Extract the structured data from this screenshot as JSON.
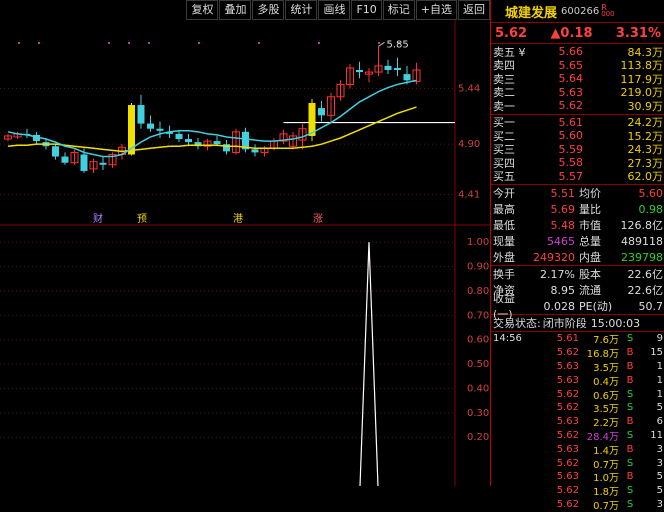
{
  "toolbar": {
    "buttons": [
      "复权",
      "叠加",
      "多股",
      "统计",
      "画线",
      "F10",
      "标记",
      "+自选",
      "返回"
    ]
  },
  "stock": {
    "name": "城建发展",
    "code": "600266",
    "badge_top": "R",
    "badge_bottom": "000",
    "price": "5.62",
    "change": "▲0.18",
    "change_pct": "3.31%"
  },
  "orderbook": {
    "asks": [
      {
        "label": "卖五 ¥",
        "price": "5.66",
        "vol": "84.3万"
      },
      {
        "label": "卖四",
        "price": "5.65",
        "vol": "113.8万"
      },
      {
        "label": "卖三",
        "price": "5.64",
        "vol": "117.9万"
      },
      {
        "label": "卖二",
        "price": "5.63",
        "vol": "219.0万"
      },
      {
        "label": "卖一",
        "price": "5.62",
        "vol": "30.9万"
      }
    ],
    "bids": [
      {
        "label": "买一",
        "price": "5.61",
        "vol": "24.2万"
      },
      {
        "label": "买二",
        "price": "5.60",
        "vol": "15.2万"
      },
      {
        "label": "买三",
        "price": "5.59",
        "vol": "24.3万"
      },
      {
        "label": "买四",
        "price": "5.58",
        "vol": "27.3万"
      },
      {
        "label": "买五",
        "price": "5.57",
        "vol": "62.0万"
      }
    ]
  },
  "stats": [
    {
      "l1": "今开",
      "v1": "5.51",
      "c1": "#ff4040",
      "l2": "均价",
      "v2": "5.60",
      "c2": "#ff4040"
    },
    {
      "l1": "最高",
      "v1": "5.69",
      "c1": "#ff4040",
      "l2": "量比",
      "v2": "0.98",
      "c2": "#30d030"
    },
    {
      "l1": "最低",
      "v1": "5.48",
      "c1": "#ff4040",
      "l2": "市值",
      "v2": "126.8亿",
      "c2": "#dddddd"
    },
    {
      "l1": "现量",
      "v1": "5465",
      "c1": "#d040d0",
      "l2": "总量",
      "v2": "489118",
      "c2": "#dddddd"
    },
    {
      "l1": "外盘",
      "v1": "249320",
      "c1": "#ff4040",
      "l2": "内盘",
      "v2": "239798",
      "c2": "#30d030"
    }
  ],
  "stats2": [
    {
      "l1": "换手",
      "v1": "2.17%",
      "c1": "#dddddd",
      "l2": "股本",
      "v2": "22.6亿",
      "c2": "#dddddd"
    },
    {
      "l1": "净资",
      "v1": "8.95",
      "c1": "#dddddd",
      "l2": "流通",
      "v2": "22.6亿",
      "c2": "#dddddd"
    },
    {
      "l1": "收益(一)",
      "v1": "0.028",
      "c1": "#dddddd",
      "l2": "PE(动)",
      "v2": "50.7",
      "c2": "#dddddd"
    }
  ],
  "status": {
    "label": "交易状态:",
    "value": "闭市阶段",
    "time": "15:00:03"
  },
  "ticks": [
    {
      "time": "14:56",
      "price": "5.61",
      "vol": "7.6万",
      "vol_color": "#f0d000",
      "side": "S",
      "n": "9"
    },
    {
      "time": "",
      "price": "5.62",
      "vol": "16.8万",
      "vol_color": "#f0d000",
      "side": "B",
      "n": "15"
    },
    {
      "time": "",
      "price": "5.63",
      "vol": "3.5万",
      "vol_color": "#f0d000",
      "side": "B",
      "n": "1"
    },
    {
      "time": "",
      "price": "5.63",
      "vol": "0.4万",
      "vol_color": "#f0d000",
      "side": "B",
      "n": "1"
    },
    {
      "time": "",
      "price": "5.62",
      "vol": "0.6万",
      "vol_color": "#f0d000",
      "side": "S",
      "n": "1"
    },
    {
      "time": "",
      "price": "5.62",
      "vol": "3.5万",
      "vol_color": "#f0d000",
      "side": "S",
      "n": "5"
    },
    {
      "time": "",
      "price": "5.63",
      "vol": "2.2万",
      "vol_color": "#f0d000",
      "side": "B",
      "n": "6"
    },
    {
      "time": "",
      "price": "5.62",
      "vol": "28.4万",
      "vol_color": "#d040d0",
      "side": "S",
      "n": "11"
    },
    {
      "time": "",
      "price": "5.63",
      "vol": "1.4万",
      "vol_color": "#f0d000",
      "side": "B",
      "n": "3"
    },
    {
      "time": "",
      "price": "5.62",
      "vol": "0.7万",
      "vol_color": "#f0d000",
      "side": "S",
      "n": "3"
    },
    {
      "time": "",
      "price": "5.63",
      "vol": "1.0万",
      "vol_color": "#f0d000",
      "side": "B",
      "n": "5"
    },
    {
      "time": "",
      "price": "5.62",
      "vol": "1.8万",
      "vol_color": "#f0d000",
      "side": "S",
      "n": "5"
    },
    {
      "time": "",
      "price": "5.62",
      "vol": "0.7万",
      "vol_color": "#f0d000",
      "side": "S",
      "n": "3"
    }
  ],
  "chart": {
    "price_labels": [
      "5.44",
      "4.90",
      "4.41"
    ],
    "peak_label": "5.85",
    "markers": [
      "财",
      "预",
      "港",
      "涨"
    ],
    "indicator_labels": [
      "1.00",
      "0.90",
      "0.80",
      "0.70",
      "0.60",
      "0.50",
      "0.40",
      "0.30",
      "0.20"
    ]
  },
  "chart_data": {
    "type": "candlestick",
    "price_axis": {
      "min": 4.3,
      "max": 5.95
    },
    "indicator_axis": {
      "min": 0.0,
      "max": 1.05
    },
    "candles": [
      [
        4.95,
        5.0,
        4.93,
        4.98
      ],
      [
        4.97,
        5.02,
        4.95,
        5.0
      ],
      [
        5.0,
        5.05,
        4.96,
        4.99
      ],
      [
        4.99,
        5.02,
        4.9,
        4.93
      ],
      [
        4.92,
        4.96,
        4.85,
        4.88
      ],
      [
        4.88,
        4.9,
        4.75,
        4.78
      ],
      [
        4.78,
        4.82,
        4.7,
        4.72
      ],
      [
        4.72,
        4.85,
        4.7,
        4.82
      ],
      [
        4.8,
        4.86,
        4.62,
        4.64
      ],
      [
        4.66,
        4.76,
        4.62,
        4.73
      ],
      [
        4.72,
        4.78,
        4.65,
        4.7
      ],
      [
        4.7,
        4.82,
        4.67,
        4.8
      ],
      [
        4.8,
        4.9,
        4.75,
        4.87
      ],
      [
        4.8,
        5.3,
        4.79,
        5.28
      ],
      [
        5.28,
        5.38,
        5.05,
        5.1
      ],
      [
        5.1,
        5.18,
        5.02,
        5.05
      ],
      [
        5.05,
        5.12,
        4.96,
        5.03
      ],
      [
        5.02,
        5.08,
        4.96,
        5.0
      ],
      [
        5.0,
        5.04,
        4.92,
        4.95
      ],
      [
        4.95,
        5.0,
        4.88,
        4.92
      ],
      [
        4.92,
        4.96,
        4.85,
        4.88
      ],
      [
        4.88,
        4.95,
        4.84,
        4.93
      ],
      [
        4.93,
        4.98,
        4.88,
        4.9
      ],
      [
        4.9,
        4.94,
        4.8,
        4.83
      ],
      [
        4.82,
        5.05,
        4.8,
        5.02
      ],
      [
        5.02,
        5.06,
        4.82,
        4.85
      ],
      [
        4.85,
        4.9,
        4.78,
        4.82
      ],
      [
        4.82,
        4.88,
        4.78,
        4.86
      ],
      [
        4.86,
        4.96,
        4.84,
        4.93
      ],
      [
        4.93,
        5.04,
        4.9,
        5.0
      ],
      [
        4.88,
        5.02,
        4.85,
        4.98
      ],
      [
        4.94,
        5.1,
        4.85,
        5.05
      ],
      [
        4.98,
        5.34,
        4.93,
        5.3
      ],
      [
        5.25,
        5.32,
        5.12,
        5.18
      ],
      [
        5.18,
        5.4,
        5.12,
        5.36
      ],
      [
        5.36,
        5.52,
        5.32,
        5.48
      ],
      [
        5.48,
        5.68,
        5.44,
        5.64
      ],
      [
        5.62,
        5.7,
        5.54,
        5.6
      ],
      [
        5.58,
        5.64,
        5.5,
        5.6
      ],
      [
        5.6,
        5.85,
        5.56,
        5.66
      ],
      [
        5.66,
        5.72,
        5.58,
        5.62
      ],
      [
        5.64,
        5.74,
        5.56,
        5.62
      ],
      [
        5.58,
        5.66,
        5.48,
        5.52
      ],
      [
        5.51,
        5.69,
        5.48,
        5.62
      ]
    ],
    "ma_short": [
      5.02,
      5.0,
      4.99,
      4.97,
      4.95,
      4.92,
      4.88,
      4.86,
      4.82,
      4.8,
      4.78,
      4.78,
      4.8,
      4.86,
      4.92,
      4.97,
      5.0,
      5.02,
      5.03,
      5.03,
      5.02,
      5.0,
      4.99,
      4.97,
      4.96,
      4.95,
      4.94,
      4.93,
      4.93,
      4.94,
      4.95,
      4.97,
      5.01,
      5.06,
      5.11,
      5.17,
      5.24,
      5.31,
      5.36,
      5.41,
      5.45,
      5.48,
      5.5,
      5.52
    ],
    "ma_long": [
      4.88,
      4.89,
      4.89,
      4.9,
      4.9,
      4.9,
      4.89,
      4.88,
      4.87,
      4.86,
      4.85,
      4.84,
      4.83,
      4.84,
      4.85,
      4.86,
      4.87,
      4.88,
      4.88,
      4.89,
      4.89,
      4.89,
      4.89,
      4.88,
      4.88,
      4.87,
      4.86,
      4.86,
      4.86,
      4.86,
      4.86,
      4.87,
      4.88,
      4.9,
      4.93,
      4.96,
      5.0,
      5.04,
      5.08,
      5.12,
      5.16,
      5.2,
      5.23,
      5.26
    ],
    "support_level": 5.11,
    "indicator_spike_index": 38,
    "indicator_spike_value": 1.0
  }
}
